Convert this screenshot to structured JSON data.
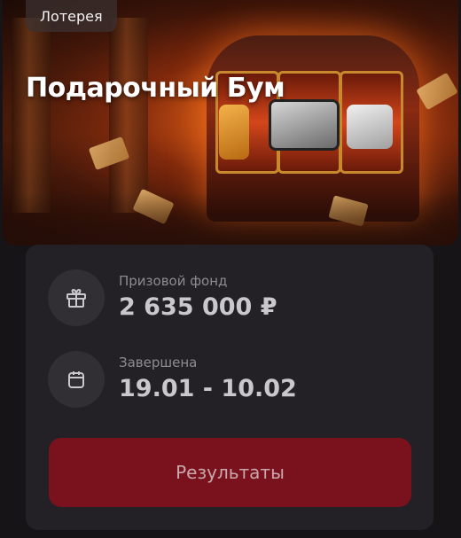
{
  "hero": {
    "badge": "Лотерея",
    "title": "Подарочный Бум"
  },
  "info": {
    "prize_label": "Призовой фонд",
    "prize_value": "2 635 000 ₽",
    "end_label": "Завершена",
    "end_value": "19.01 - 10.02"
  },
  "actions": {
    "results_label": "Результаты"
  },
  "icons": {
    "prize": "gift-icon",
    "date": "calendar-icon"
  },
  "colors": {
    "background": "#161417",
    "card": "#232125",
    "button": "#7a121e"
  }
}
